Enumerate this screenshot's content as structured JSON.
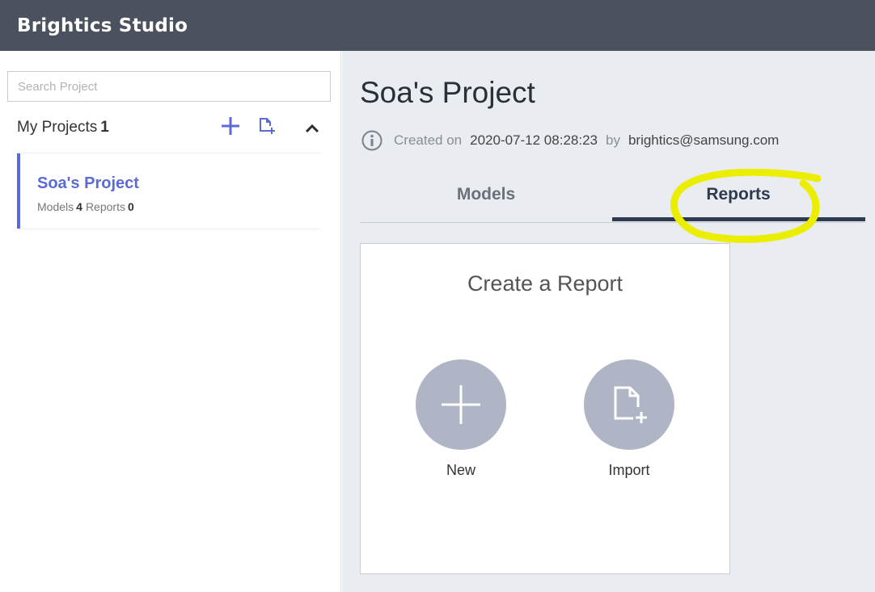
{
  "app": {
    "title": "Brightics Studio"
  },
  "sidebar": {
    "search_placeholder": "Search Project",
    "projects_label": "My Projects",
    "projects_count": "1",
    "projects": [
      {
        "name": "Soa's Project",
        "models_label": "Models",
        "models_count": "4",
        "reports_label": "Reports",
        "reports_count": "0"
      }
    ]
  },
  "main": {
    "title": "Soa's Project",
    "info": {
      "created_label": "Created on",
      "created_value": "2020-07-12 08:28:23",
      "by_label": "by",
      "author": "brightics@samsung.com"
    },
    "tabs": [
      {
        "label": "Models",
        "active": false
      },
      {
        "label": "Reports",
        "active": true
      }
    ],
    "card": {
      "title": "Create a Report",
      "new_label": "New",
      "import_label": "Import"
    }
  },
  "colors": {
    "accent": "#5b6bd6",
    "topbar": "#4b515e",
    "active_tab": "#2e3a4e",
    "circle": "#b0b5c6",
    "highlight": "#ebee00"
  },
  "icons": [
    "plus-icon",
    "file-import-icon",
    "chevron-up-icon",
    "info-icon",
    "plus-icon",
    "file-import-icon"
  ]
}
